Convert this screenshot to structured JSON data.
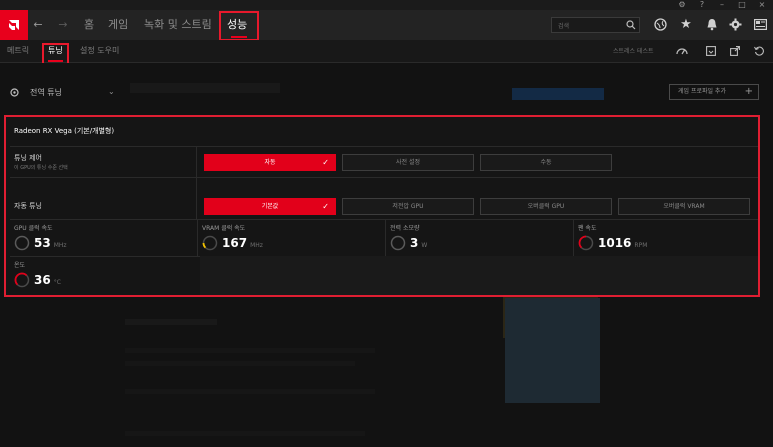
{
  "window": {
    "controls": [
      "⚙",
      "?",
      "–",
      "□",
      "×"
    ]
  },
  "nav": {
    "tabs": [
      {
        "label": "홈"
      },
      {
        "label": "게임"
      },
      {
        "label": "녹화 및 스트림"
      },
      {
        "label": "성능"
      }
    ],
    "active_tab": "성능",
    "search_placeholder": "검색",
    "icons": [
      "back-arrow-icon",
      "forward-arrow-icon",
      "search-icon",
      "web-icon",
      "star-icon",
      "bell-icon",
      "gear-icon",
      "panel-icon"
    ]
  },
  "subnav": {
    "tabs": [
      {
        "label": "메트릭"
      },
      {
        "label": "튜닝"
      },
      {
        "label": "설정 도우미"
      }
    ],
    "active_tab": "튜닝",
    "stress_test": "스트레스 테스트"
  },
  "tuning_select": {
    "label": "전역 튜닝"
  },
  "add_profile": {
    "label": "게임 프로파일 추가",
    "plus": "+"
  },
  "panel": {
    "gpu_name": "Radeon RX Vega (기본/개별형)",
    "tuning_control": {
      "label": "튜닝 제어",
      "sub": "이 GPU의 튜닝 수준 선택",
      "options": [
        {
          "label": "자동",
          "active": true
        },
        {
          "label": "사전 설정",
          "active": false
        },
        {
          "label": "수동",
          "active": false
        }
      ]
    },
    "auto_tuning": {
      "label": "자동 튜닝",
      "options": [
        {
          "label": "기본값",
          "active": true
        },
        {
          "label": "저전압 GPU",
          "active": false
        },
        {
          "label": "오버클럭 GPU",
          "active": false
        },
        {
          "label": "오버클럭 VRAM",
          "active": false
        }
      ]
    },
    "metrics": [
      {
        "label": "GPU 클럭 속도",
        "value": "53",
        "unit": "MHz",
        "gauge_color": "#5a5a5a"
      },
      {
        "label": "VRAM 클럭 속도",
        "value": "167",
        "unit": "MHz",
        "gauge_color": "#f2c200"
      },
      {
        "label": "전력 소모량",
        "value": "3",
        "unit": "W",
        "gauge_color": "#5a5a5a"
      },
      {
        "label": "팬 속도",
        "value": "1016",
        "unit": "RPM",
        "gauge_color": "#e2001a"
      }
    ],
    "temperature": {
      "label": "온도",
      "value": "36",
      "unit": "°C",
      "gauge_color": "#e2001a"
    }
  },
  "colors": {
    "accent": "#e2001a",
    "highlight_box": "#e8192c",
    "background": "#101010"
  }
}
